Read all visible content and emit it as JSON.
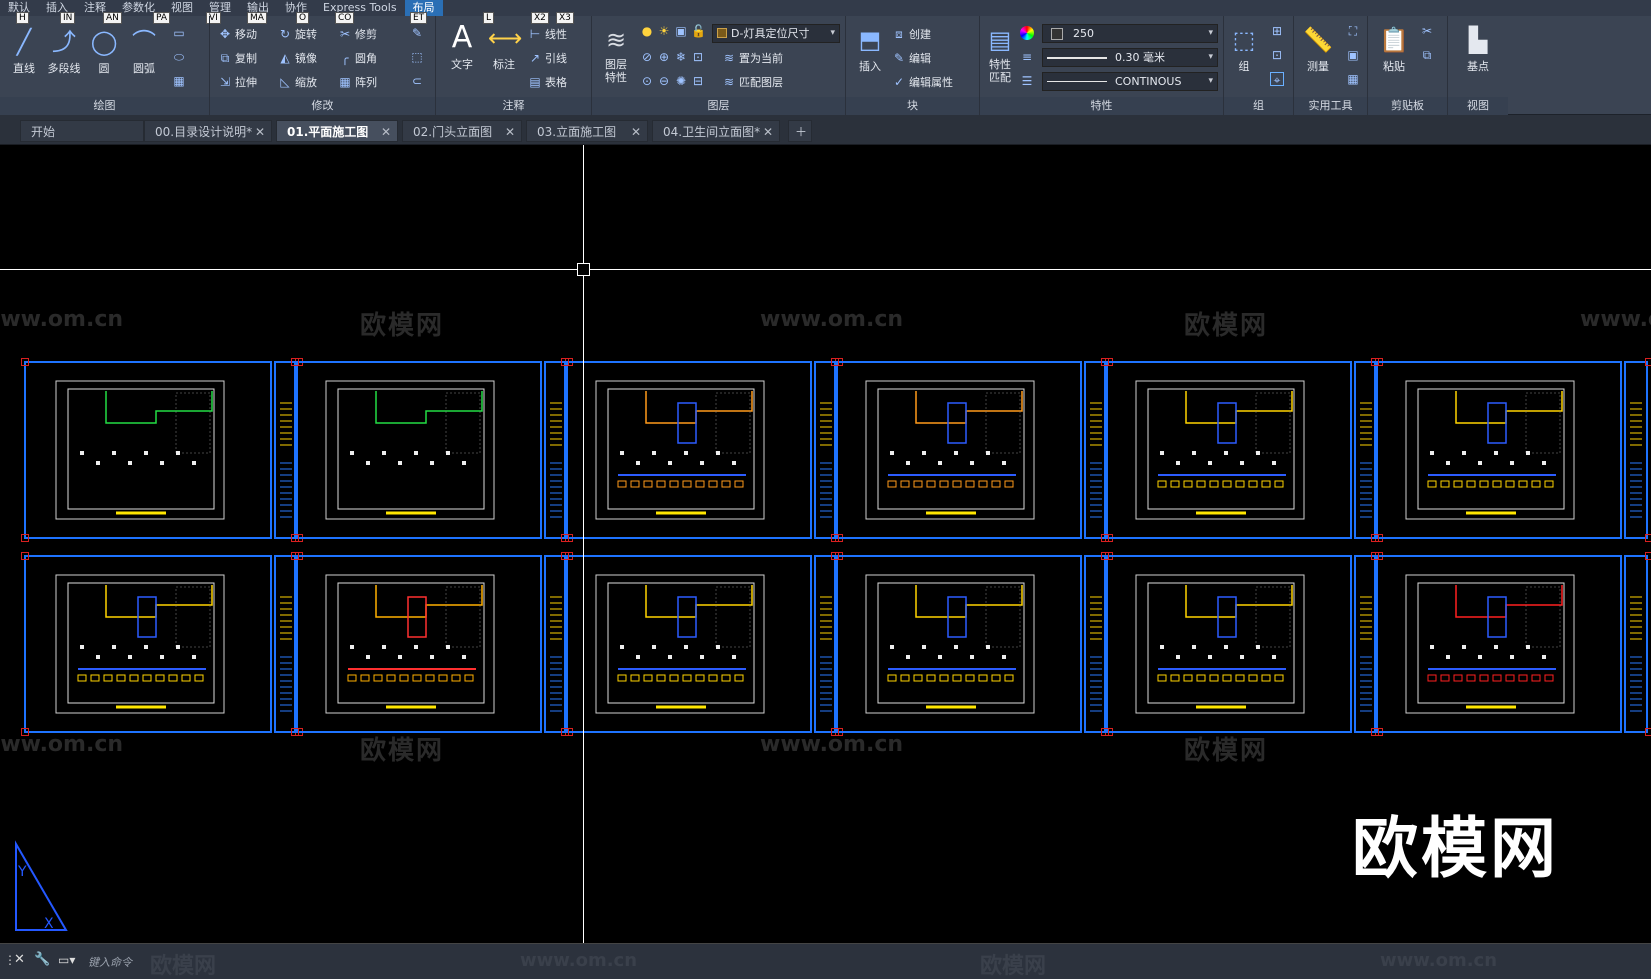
{
  "menu": {
    "tabs": [
      "默认",
      "插入",
      "注释",
      "参数化",
      "视图",
      "管理",
      "输出",
      "协作",
      "Express Tools",
      "布局"
    ],
    "active": "布局",
    "keytips": [
      "H",
      "IN",
      "AN",
      "PA",
      "VI",
      "MA",
      "O",
      "CO",
      "ET",
      "L",
      "X2",
      "X3"
    ]
  },
  "ribbon": {
    "draw": {
      "title": "绘图",
      "line": "直线",
      "polyline": "多段线",
      "circle": "圆",
      "arc": "圆弧"
    },
    "modify": {
      "title": "修改",
      "move": "移动",
      "rotate": "旋转",
      "trim": "修剪",
      "copy": "复制",
      "mirror": "镜像",
      "fillet": "圆角",
      "stretch": "拉伸",
      "scale": "缩放",
      "array": "阵列"
    },
    "annotation": {
      "title": "注释",
      "text": "文字",
      "dimension": "标注",
      "linear": "线性",
      "leader": "引线",
      "table": "表格"
    },
    "layers": {
      "title": "图层",
      "layer_props": "图层特性",
      "current_layer": "D-灯具定位尺寸",
      "set_current": "置为当前",
      "match_layer": "匹配图层"
    },
    "block": {
      "title": "块",
      "insert": "插入",
      "create": "创建",
      "edit": "编辑",
      "edit_attr": "编辑属性"
    },
    "properties": {
      "title": "特性",
      "match": "特性匹配",
      "color": "250",
      "lineweight": "0.30 毫米",
      "linetype": "CONTINOUS"
    },
    "groups": {
      "title": "组",
      "group": "组"
    },
    "utilities": {
      "title": "实用工具",
      "measure": "测量"
    },
    "clipboard": {
      "title": "剪贴板",
      "paste": "粘贴"
    },
    "view": {
      "title": "视图",
      "basepoint": "基点"
    }
  },
  "doc_tabs": [
    {
      "label": "开始",
      "closable": false
    },
    {
      "label": "00.目录设计说明*",
      "closable": true
    },
    {
      "label": "01.平面施工图",
      "closable": true,
      "active": true
    },
    {
      "label": "02.门头立面图",
      "closable": true
    },
    {
      "label": "03.立面施工图",
      "closable": true
    },
    {
      "label": "04.卫生间立面图*",
      "closable": true
    }
  ],
  "canvas": {
    "watermark_cn": "欧模网",
    "watermark_url": "www.om.cn",
    "big_watermark": "欧模网",
    "ucs_labels": [
      "Y",
      "X"
    ]
  },
  "command": {
    "placeholder": "键入命令"
  },
  "colors": {
    "sheet_border": "#1e73ff",
    "crosshair": "#ffffff",
    "ribbon_bg": "#3b4453"
  }
}
